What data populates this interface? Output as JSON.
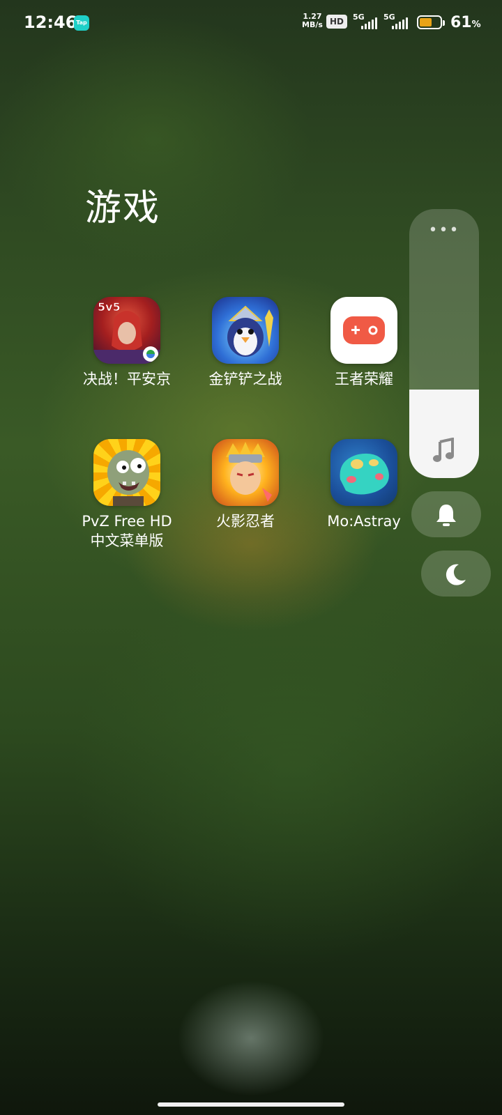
{
  "status_bar": {
    "time": "12:46",
    "notification_app": "TapTap",
    "notification_label": "Tap",
    "net_speed_value": "1.27",
    "net_speed_unit": "MB/s",
    "hd_label": "HD",
    "signal_1_label": "5G",
    "signal_2_label": "5G",
    "battery_percent": "61",
    "battery_unit": "%",
    "battery_level": 0.61
  },
  "folder": {
    "title": "游戏",
    "apps": [
      {
        "label": "决战！平安京",
        "icon": "onmyoji-arena-icon"
      },
      {
        "label": "金铲铲之战",
        "icon": "penguin-game-icon"
      },
      {
        "label": "王者荣耀",
        "icon": "gamepad-icon"
      },
      {
        "label": "PvZ Free HD\n中文菜单版",
        "label_line1": "PvZ Free HD",
        "label_line2": "中文菜单版",
        "icon": "zombie-icon"
      },
      {
        "label": "火影忍者",
        "icon": "ninja-icon"
      },
      {
        "label": "Mo:Astray",
        "icon": "slime-icon"
      }
    ]
  },
  "volume_panel": {
    "more_icon": "more-dots-icon",
    "media_icon": "music-note-icon",
    "level": 0.33,
    "ring_icon": "bell-icon",
    "dnd_icon": "moon-icon"
  },
  "colors": {
    "accent_tap": "#1fd0c8",
    "battery_fill": "#e8a317",
    "gamepad_red": "#f05a45"
  }
}
